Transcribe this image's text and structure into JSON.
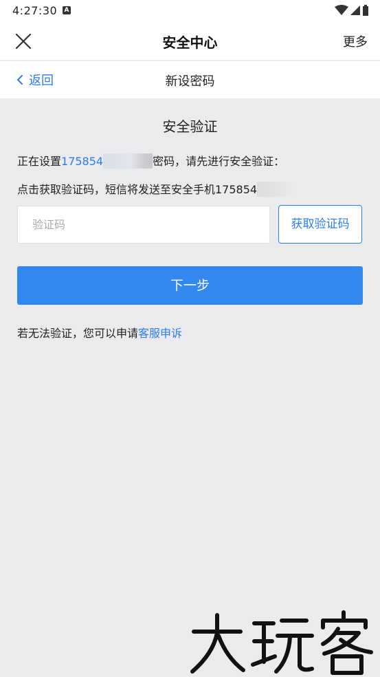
{
  "status_bar": {
    "time": "4:27:30",
    "badge": "A"
  },
  "app_bar": {
    "title": "安全中心",
    "more_label": "更多"
  },
  "sub_bar": {
    "back_label": "返回",
    "title": "新设密码"
  },
  "main": {
    "section_title": "安全验证",
    "line1_prefix": "正在设置",
    "line1_account": "175854",
    "line1_suffix": "密码，请先进行安全验证：",
    "line2_text": "点击获取验证码，短信将发送至安全手机175854",
    "code_input": {
      "placeholder": "验证码",
      "value": ""
    },
    "get_code_label": "获取验证码",
    "next_label": "下一步",
    "help_prefix": "若无法验证，您可以申请",
    "help_link": "客服申诉"
  },
  "watermark_text": "大玩客",
  "colors": {
    "accent": "#2c7ee8",
    "button": "#3388f0",
    "background": "#ebebed"
  }
}
